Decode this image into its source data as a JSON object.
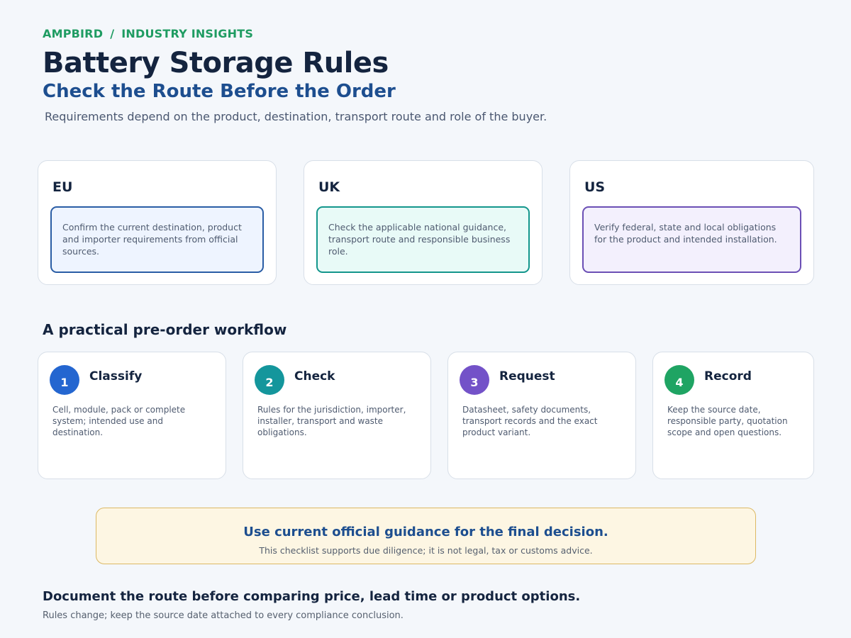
{
  "breadcrumb": {
    "brand": "AMPBIRD",
    "separator": "/",
    "section": "INDUSTRY INSIGHTS"
  },
  "header": {
    "title": "Battery Storage Rules",
    "subtitle": "Check the Route Before the Order",
    "intro": "Requirements depend on the product, destination, transport route and role of the buyer."
  },
  "regions": [
    {
      "name": "EU",
      "note": "Confirm the current destination, product and importer requirements from official sources.",
      "accent": "#2a5da5",
      "tint": "#eef4ff"
    },
    {
      "name": "UK",
      "note": "Check the applicable national guidance, transport route and responsible business role.",
      "accent": "#13968c",
      "tint": "#e8faf7"
    },
    {
      "name": "US",
      "note": "Verify federal, state and local obligations for the product and intended installation.",
      "accent": "#6b4fb5",
      "tint": "#f3f0fd"
    }
  ],
  "workflow": {
    "heading": "A practical pre-order workflow",
    "steps": [
      {
        "number": "1",
        "title": "Classify",
        "description": "Cell, module, pack or complete system; intended use and destination.",
        "color": "#2466d0"
      },
      {
        "number": "2",
        "title": "Check",
        "description": "Rules for the jurisdiction, importer, installer, transport and waste obligations.",
        "color": "#14969c"
      },
      {
        "number": "3",
        "title": "Request",
        "description": "Datasheet, safety documents, transport records and the exact product variant.",
        "color": "#7352c8"
      },
      {
        "number": "4",
        "title": "Record",
        "description": "Keep the source date, responsible party, quotation scope and open questions.",
        "color": "#1fa463"
      }
    ]
  },
  "callout": {
    "title": "Use current official guidance for the final decision.",
    "text": "This checklist supports due diligence; it is not legal, tax or customs advice."
  },
  "footer": {
    "title": "Document the route before comparing price, lead time or product options.",
    "text": "Rules change; keep the source date attached to every compliance conclusion."
  }
}
